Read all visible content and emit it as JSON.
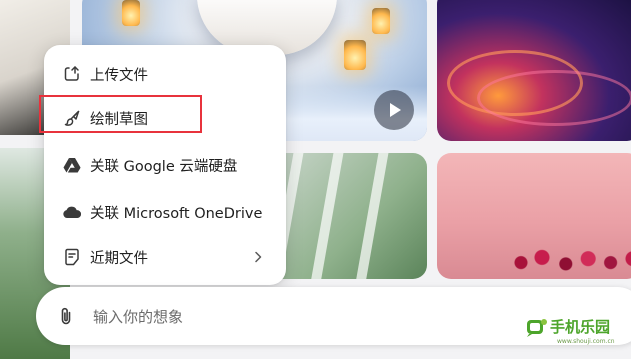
{
  "menu": {
    "items": [
      {
        "label": "上传文件",
        "icon": "upload-file-icon"
      },
      {
        "label": "绘制草图",
        "icon": "brush-icon"
      },
      {
        "label": "关联 Google 云端硬盘",
        "icon": "google-drive-icon"
      },
      {
        "label": "关联 Microsoft OneDrive",
        "icon": "onedrive-cloud-icon"
      },
      {
        "label": "近期文件",
        "icon": "recent-file-icon",
        "submenu_icon": "chevron-right-icon"
      }
    ]
  },
  "prompt": {
    "placeholder": "输入你的想象",
    "value": "",
    "attach_icon": "paperclip-icon"
  },
  "watermark": {
    "brand": "手机乐园",
    "url": "www.shouji.com.cn"
  },
  "colors": {
    "highlight_border": "#e8323c",
    "menu_bg": "#ffffff",
    "page_bg": "#f3f3f5",
    "watermark_green": "#4da52b"
  }
}
